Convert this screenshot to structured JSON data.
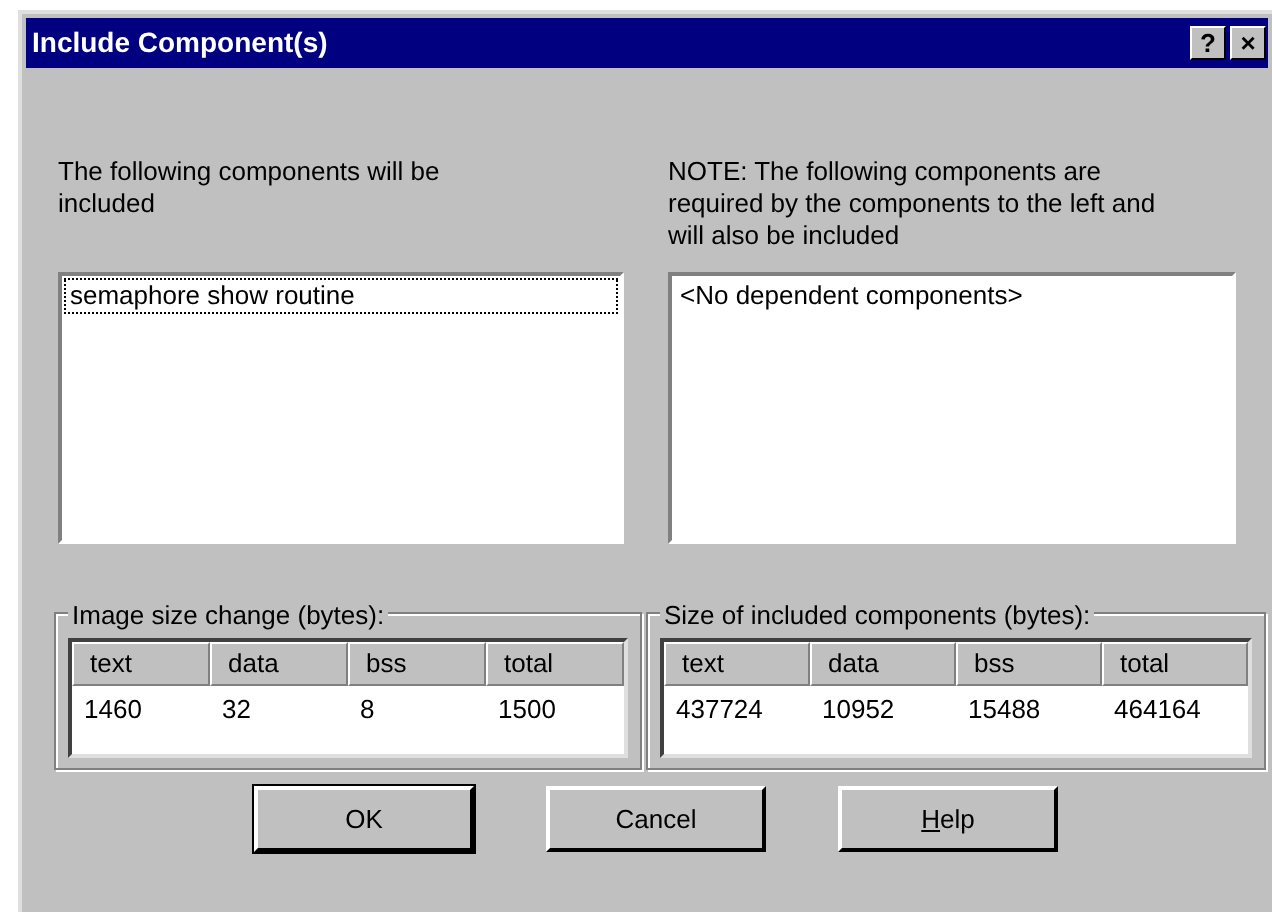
{
  "window": {
    "title": "Include Component(s)",
    "title_buttons": [
      "?",
      "×"
    ]
  },
  "left_panel": {
    "label": "The following components will be included",
    "items": [
      {
        "text": "semaphore show routine",
        "focused": true
      }
    ]
  },
  "right_panel": {
    "label": "NOTE: The following components are required  by the components to the left and will also be included",
    "items": [
      {
        "text": "<No dependent components>",
        "focused": false
      }
    ]
  },
  "size_groups": [
    {
      "title": "Image size change (bytes):",
      "columns": [
        "text",
        "data",
        "bss",
        "total"
      ],
      "values": [
        "1460",
        "32",
        "8",
        "1500"
      ]
    },
    {
      "title": "Size of included components (bytes):",
      "columns": [
        "text",
        "data",
        "bss",
        "total"
      ],
      "values": [
        "437724",
        "10952",
        "15488",
        "464164"
      ]
    }
  ],
  "buttons": [
    {
      "label": "OK",
      "default": true,
      "underline_first": false
    },
    {
      "label": "Cancel",
      "default": false,
      "underline_first": false
    },
    {
      "label": "Help",
      "default": false,
      "underline_first": true
    }
  ]
}
